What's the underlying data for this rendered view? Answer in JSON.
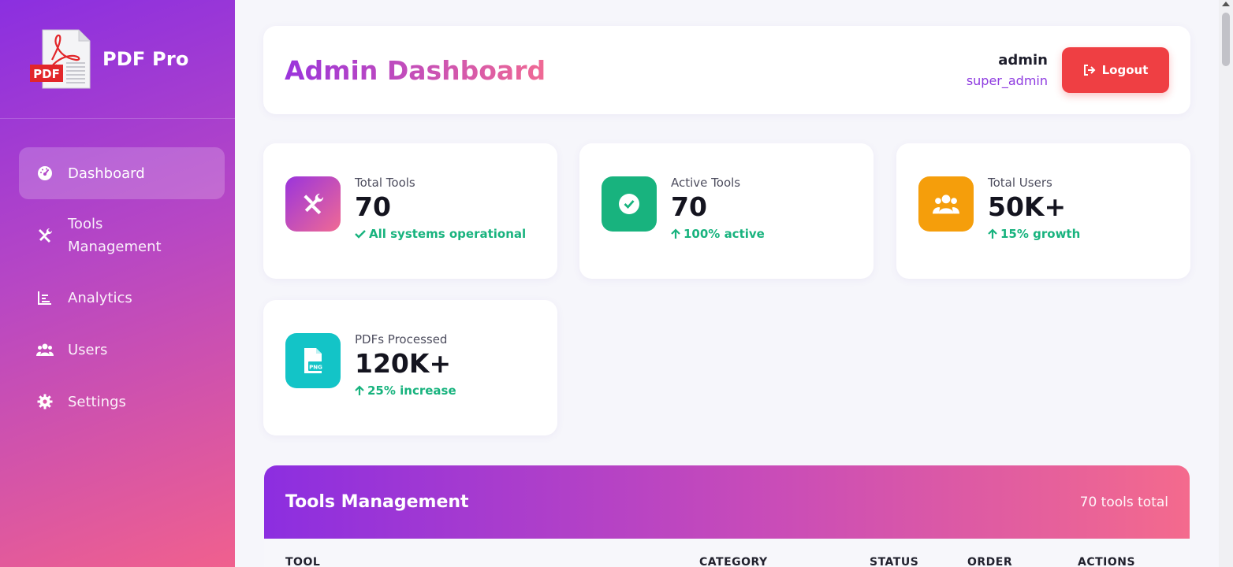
{
  "brand": {
    "name": "PDF Pro",
    "logo_text": "PDF"
  },
  "sidebar": {
    "items": [
      {
        "label": "Dashboard",
        "icon": "gauge-icon",
        "active": true
      },
      {
        "label": "Tools Management",
        "line1": "Tools",
        "line2": "Management",
        "icon": "tools-icon"
      },
      {
        "label": "Analytics",
        "icon": "chart-icon"
      },
      {
        "label": "Users",
        "icon": "users-icon"
      },
      {
        "label": "Settings",
        "icon": "gear-icon"
      }
    ]
  },
  "header": {
    "title": "Admin Dashboard",
    "user_name": "admin",
    "user_role": "super_admin",
    "logout_label": "Logout"
  },
  "stats": [
    {
      "label": "Total Tools",
      "value": "70",
      "sub": "All systems operational",
      "sub_icon": "check-icon",
      "icon": "tools-icon",
      "color": "#a13fd7"
    },
    {
      "label": "Active Tools",
      "value": "70",
      "sub": "100% active",
      "sub_icon": "arrow-up-icon",
      "icon": "check-circle-icon",
      "color": "#18b37e"
    },
    {
      "label": "Total Users",
      "value": "50K+",
      "sub": "15% growth",
      "sub_icon": "arrow-up-icon",
      "icon": "users-icon",
      "color": "#f59e0b"
    },
    {
      "label": "PDFs Processed",
      "value": "120K+",
      "sub": "25% increase",
      "sub_icon": "arrow-up-icon",
      "icon": "file-png-icon",
      "color": "#13c4c7"
    }
  ],
  "tools": {
    "title": "Tools Management",
    "count": "70 tools total",
    "columns": [
      "TOOL",
      "CATEGORY",
      "STATUS",
      "ORDER",
      "ACTIONS"
    ]
  },
  "colors": {
    "accent_purple": "#8b2fe0",
    "accent_pink": "#f0608e",
    "danger": "#ef3f43",
    "success": "#18b37e"
  }
}
